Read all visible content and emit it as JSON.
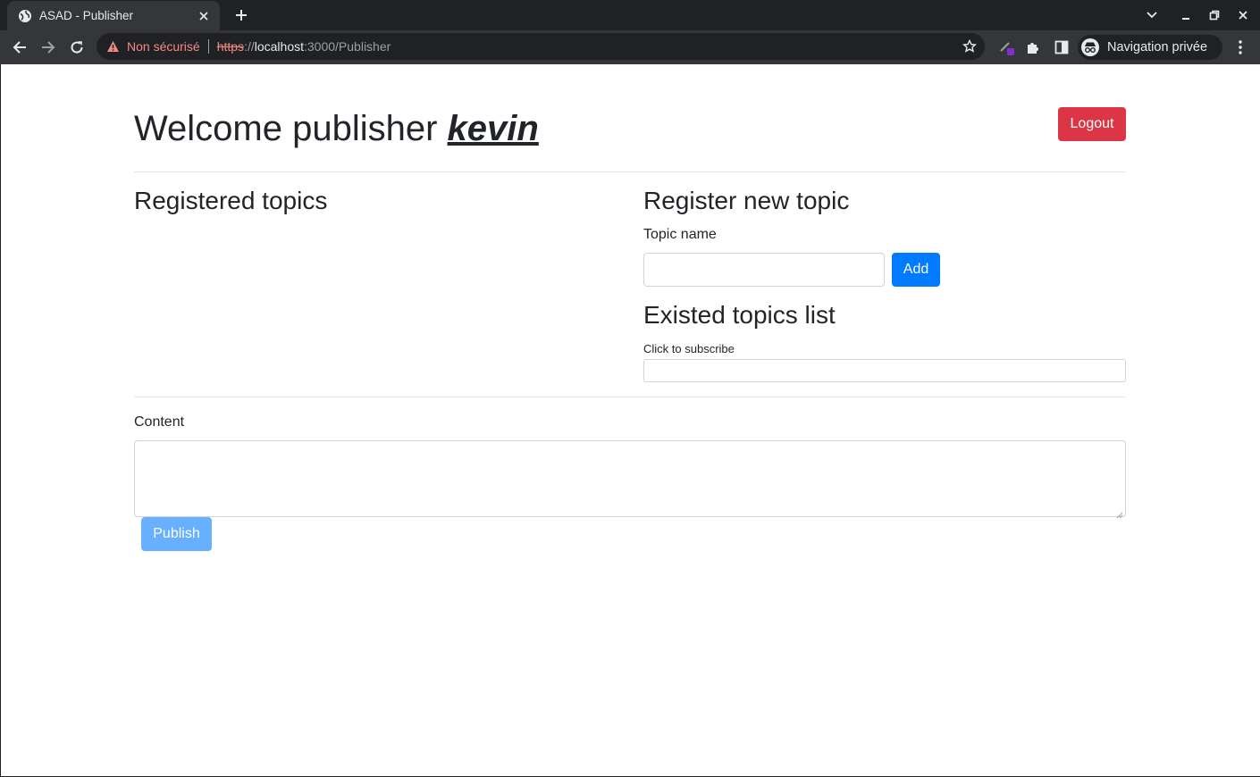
{
  "browser": {
    "tab_title": "ASAD - Publisher",
    "omnibox": {
      "security_label": "Non sécurisé",
      "url_scheme": "https",
      "url_separator": "://",
      "url_host": "localhost",
      "url_rest": ":3000/Publisher"
    },
    "profile_label": "Navigation privée"
  },
  "page": {
    "title_prefix": "Welcome publisher ",
    "username": "kevin",
    "logout_label": "Logout",
    "registered_topics": {
      "heading": "Registered topics",
      "items": []
    },
    "register_new_topic": {
      "heading": "Register new topic",
      "field_label": "Topic name",
      "field_value": "",
      "add_label": "Add"
    },
    "existed_topics": {
      "heading": "Existed topics list",
      "hint": "Click to subscribe",
      "items": []
    },
    "content": {
      "label": "Content",
      "value": "",
      "publish_label": "Publish"
    }
  },
  "colors": {
    "danger": "#dc3545",
    "primary": "#007bff",
    "primary_disabled": "#66b0ff",
    "browser_frame": "#202124",
    "browser_toolbar": "#35363a",
    "not_secure": "#f28b82"
  }
}
